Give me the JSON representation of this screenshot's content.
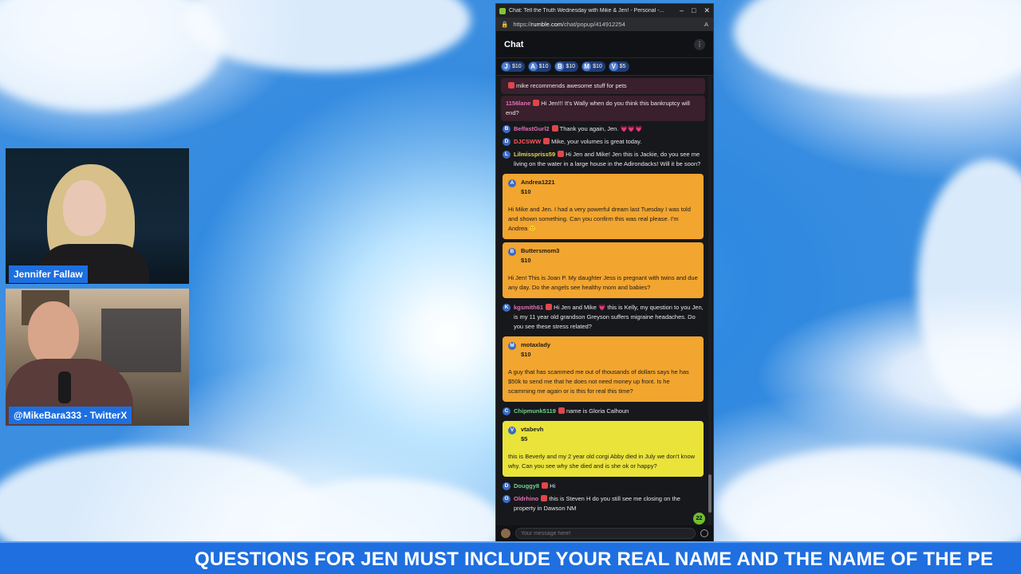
{
  "colors": {
    "ticker_bg": "#1f6fe0",
    "orange_tip": "#f2a52f",
    "yellow_tip": "#eae33a",
    "rumble_green": "#85c742"
  },
  "cams": [
    {
      "name": "Jennifer Fallaw"
    },
    {
      "name": "@MikeBara333 - TwitterX"
    }
  ],
  "browser": {
    "title": "Chat: Tell the Truth Wednesday with Mike & Jen! - Personal -...",
    "url_prefix": "https://",
    "url_domain": "rumble.com",
    "url_path": "/chat/popup/414912254"
  },
  "chat": {
    "header": "Chat",
    "tips": [
      {
        "letter": "J",
        "amount": "$10"
      },
      {
        "letter": "A",
        "amount": "$10"
      },
      {
        "letter": "B",
        "amount": "$10"
      },
      {
        "letter": "M",
        "amount": "$10"
      },
      {
        "letter": "V",
        "amount": "$5"
      }
    ],
    "messages": [
      {
        "kind": "hl",
        "letter": "",
        "user": "",
        "user_color": "#e36fb5",
        "text": "mike recommends awesome stuff for pets"
      },
      {
        "kind": "hl",
        "letter": "",
        "user": "1156lane",
        "user_color": "#e36fb5",
        "text": "Hi Jen!!! It's Wally when do you think this bankruptcy will end?"
      },
      {
        "kind": "plain",
        "letter": "B",
        "user": "BelfastGurl2",
        "user_color": "#e36fb5",
        "text": "Thank you again, Jen. 💗💗💗"
      },
      {
        "kind": "plain",
        "letter": "D",
        "user": "DJCSWW",
        "user_color": "#ff5a5a",
        "text": "Mike, your volumes is great today."
      },
      {
        "kind": "plain",
        "letter": "L",
        "user": "Lilmisspriss59",
        "user_color": "#e8d34a",
        "text": "Hi Jen and Mike! Jen this is Jackie, do you see me living on the water in a large house in the Adirondacks! Will it be soon?"
      },
      {
        "kind": "card",
        "style": "orange",
        "letter": "A",
        "user": "Andrea1221",
        "amount": "$10",
        "text": "Hi Mike and Jen. I had a very powerful dream last Tuesday I was told and shown something. Can you confirm this was real please. I'm Andrea 🙂"
      },
      {
        "kind": "card",
        "style": "orange",
        "letter": "B",
        "user": "Buttersmom3",
        "amount": "$10",
        "text": "Hi Jen! This is Joan P. My daughter Jess is pregnant with twins and due any day. Do the angels see healthy mom and babies?"
      },
      {
        "kind": "plain",
        "letter": "K",
        "user": "kgsmith61",
        "user_color": "#e36fb5",
        "text": "Hi Jen and Mike 💗 this is Kelly, my question to you Jen, is my 11 year old grandson Greyson suffers migraine headaches. Do you see these stress related?"
      },
      {
        "kind": "card",
        "style": "orange",
        "letter": "M",
        "user": "motaxlady",
        "amount": "$10",
        "text": "A guy that has scammed me out of thousands of dollars says he has $50k to send me that he does not need money up front. Is he scamming me again or is this for real this time?"
      },
      {
        "kind": "plain",
        "letter": "C",
        "user": "Chipmunk5119",
        "user_color": "#6fd08a",
        "text": "name is Gloria Calhoun"
      },
      {
        "kind": "card",
        "style": "yellow",
        "letter": "V",
        "user": "vtabevh",
        "amount": "$5",
        "text": "this is Beverly and my 2 year old corgi Abby died in July we don't know why. Can you see why she died and is she ok or happy?"
      },
      {
        "kind": "plain",
        "letter": "D",
        "user": "Douggy8",
        "user_color": "#6fd08a",
        "text": "Hi"
      },
      {
        "kind": "plain",
        "letter": "O",
        "user": "Oldrhino",
        "user_color": "#e36fb5",
        "text": "this is Steven H do you still see me closing on the property in Dawson NM"
      }
    ],
    "unread_count": "22",
    "input_placeholder": "Your message here!"
  },
  "ticker": {
    "text": "QUESTIONS FOR JEN MUST INCLUDE YOUR REAL NAME AND THE NAME OF THE PE"
  }
}
